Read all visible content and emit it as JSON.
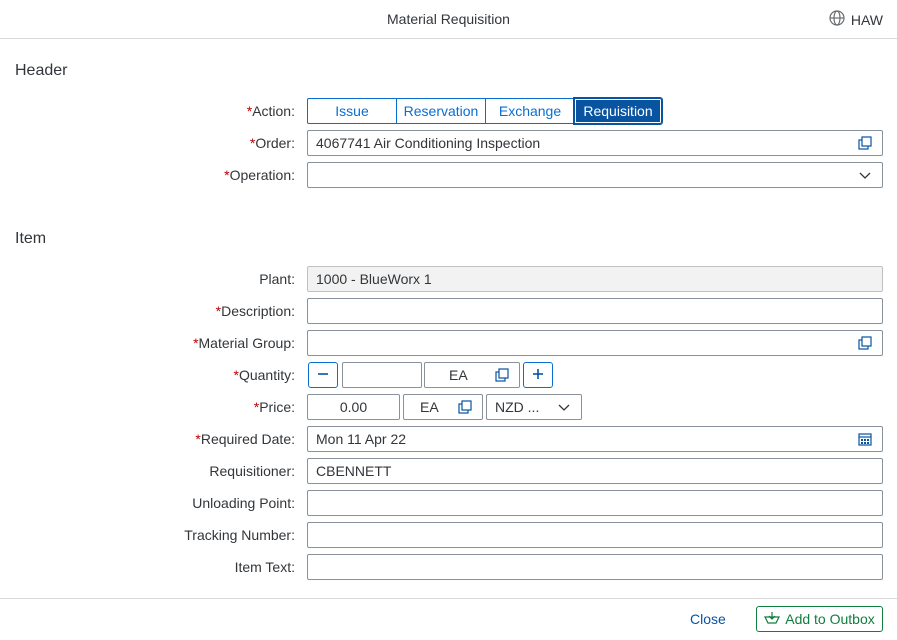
{
  "topbar": {
    "title": "Material Requisition",
    "user": "HAW",
    "user_icon": "globe-icon"
  },
  "header": {
    "section_title": "Header",
    "action": {
      "label": "Action:",
      "required": "*",
      "options": [
        "Issue",
        "Reservation",
        "Exchange",
        "Requisition"
      ],
      "selected": "Requisition"
    },
    "order": {
      "label": "Order:",
      "required": "*",
      "value": "4067741 Air Conditioning Inspection"
    },
    "operation": {
      "label": "Operation:",
      "required": "*",
      "value": ""
    }
  },
  "item": {
    "section_title": "Item",
    "plant": {
      "label": "Plant:",
      "value": "1000 - BlueWorx 1"
    },
    "description": {
      "label": "Description:",
      "required": "*",
      "value": ""
    },
    "material_group": {
      "label": "Material Group:",
      "required": "*",
      "value": ""
    },
    "quantity": {
      "label": "Quantity:",
      "required": "*",
      "value": "",
      "unit": "EA"
    },
    "price": {
      "label": "Price:",
      "required": "*",
      "value": "0.00",
      "unit": "EA",
      "currency": "NZD ..."
    },
    "required_date": {
      "label": "Required Date:",
      "required": "*",
      "value": "Mon 11 Apr 22"
    },
    "requisitioner": {
      "label": "Requisitioner:",
      "value": "CBENNETT"
    },
    "unloading_point": {
      "label": "Unloading Point:",
      "value": ""
    },
    "tracking_number": {
      "label": "Tracking Number:",
      "value": ""
    },
    "item_text": {
      "label": "Item Text:",
      "value": ""
    }
  },
  "footer": {
    "close_label": "Close",
    "add_label": "Add to Outbox"
  },
  "colors": {
    "accent": "#0854a0",
    "required": "#bb0000",
    "positive": "#107e3e"
  }
}
